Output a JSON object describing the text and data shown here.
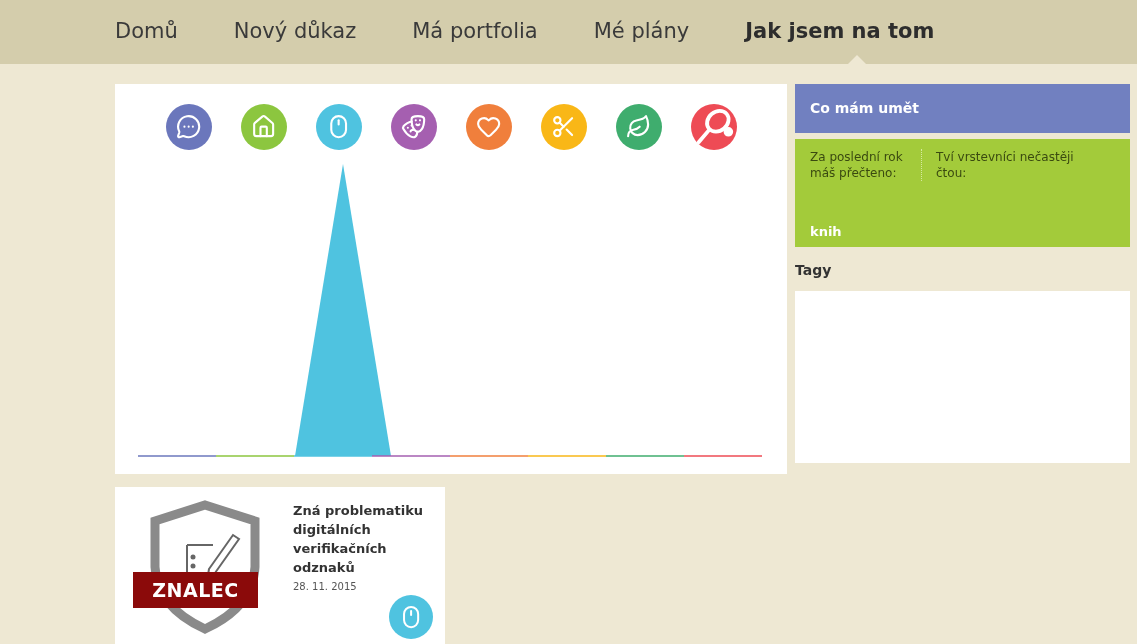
{
  "nav": [
    {
      "label": "Domů",
      "selected": false
    },
    {
      "label": "Nový důkaz",
      "selected": false
    },
    {
      "label": "Má portfolia",
      "selected": false
    },
    {
      "label": "Mé plány",
      "selected": false
    },
    {
      "label": "Jak jsem na tom",
      "selected": true
    }
  ],
  "areas": [
    {
      "kind": "speech",
      "color": "#6b77bc"
    },
    {
      "kind": "home",
      "color": "#8cc63f"
    },
    {
      "kind": "mouse",
      "color": "#4fc3e0"
    },
    {
      "kind": "masks",
      "color": "#a55fb0"
    },
    {
      "kind": "heart",
      "color": "#f07f3c"
    },
    {
      "kind": "craft",
      "color": "#f9b717"
    },
    {
      "kind": "leaf",
      "color": "#3fad6e"
    },
    {
      "kind": "racket",
      "color": "#ee4b55"
    }
  ],
  "skills": {
    "title": "Co mám umět",
    "read_label": "Za poslední rok máš přečteno:",
    "peers_label": "Tví vrstevníci nečastěji čtou:",
    "unit": "knih"
  },
  "tags": {
    "title": "Tagy"
  },
  "badges": [
    {
      "banner": "ZNALEC",
      "title": "Zná problematiku digitálních verifikačních odznaků",
      "date": "28. 11. 2015",
      "kind": "mouse"
    }
  ]
}
